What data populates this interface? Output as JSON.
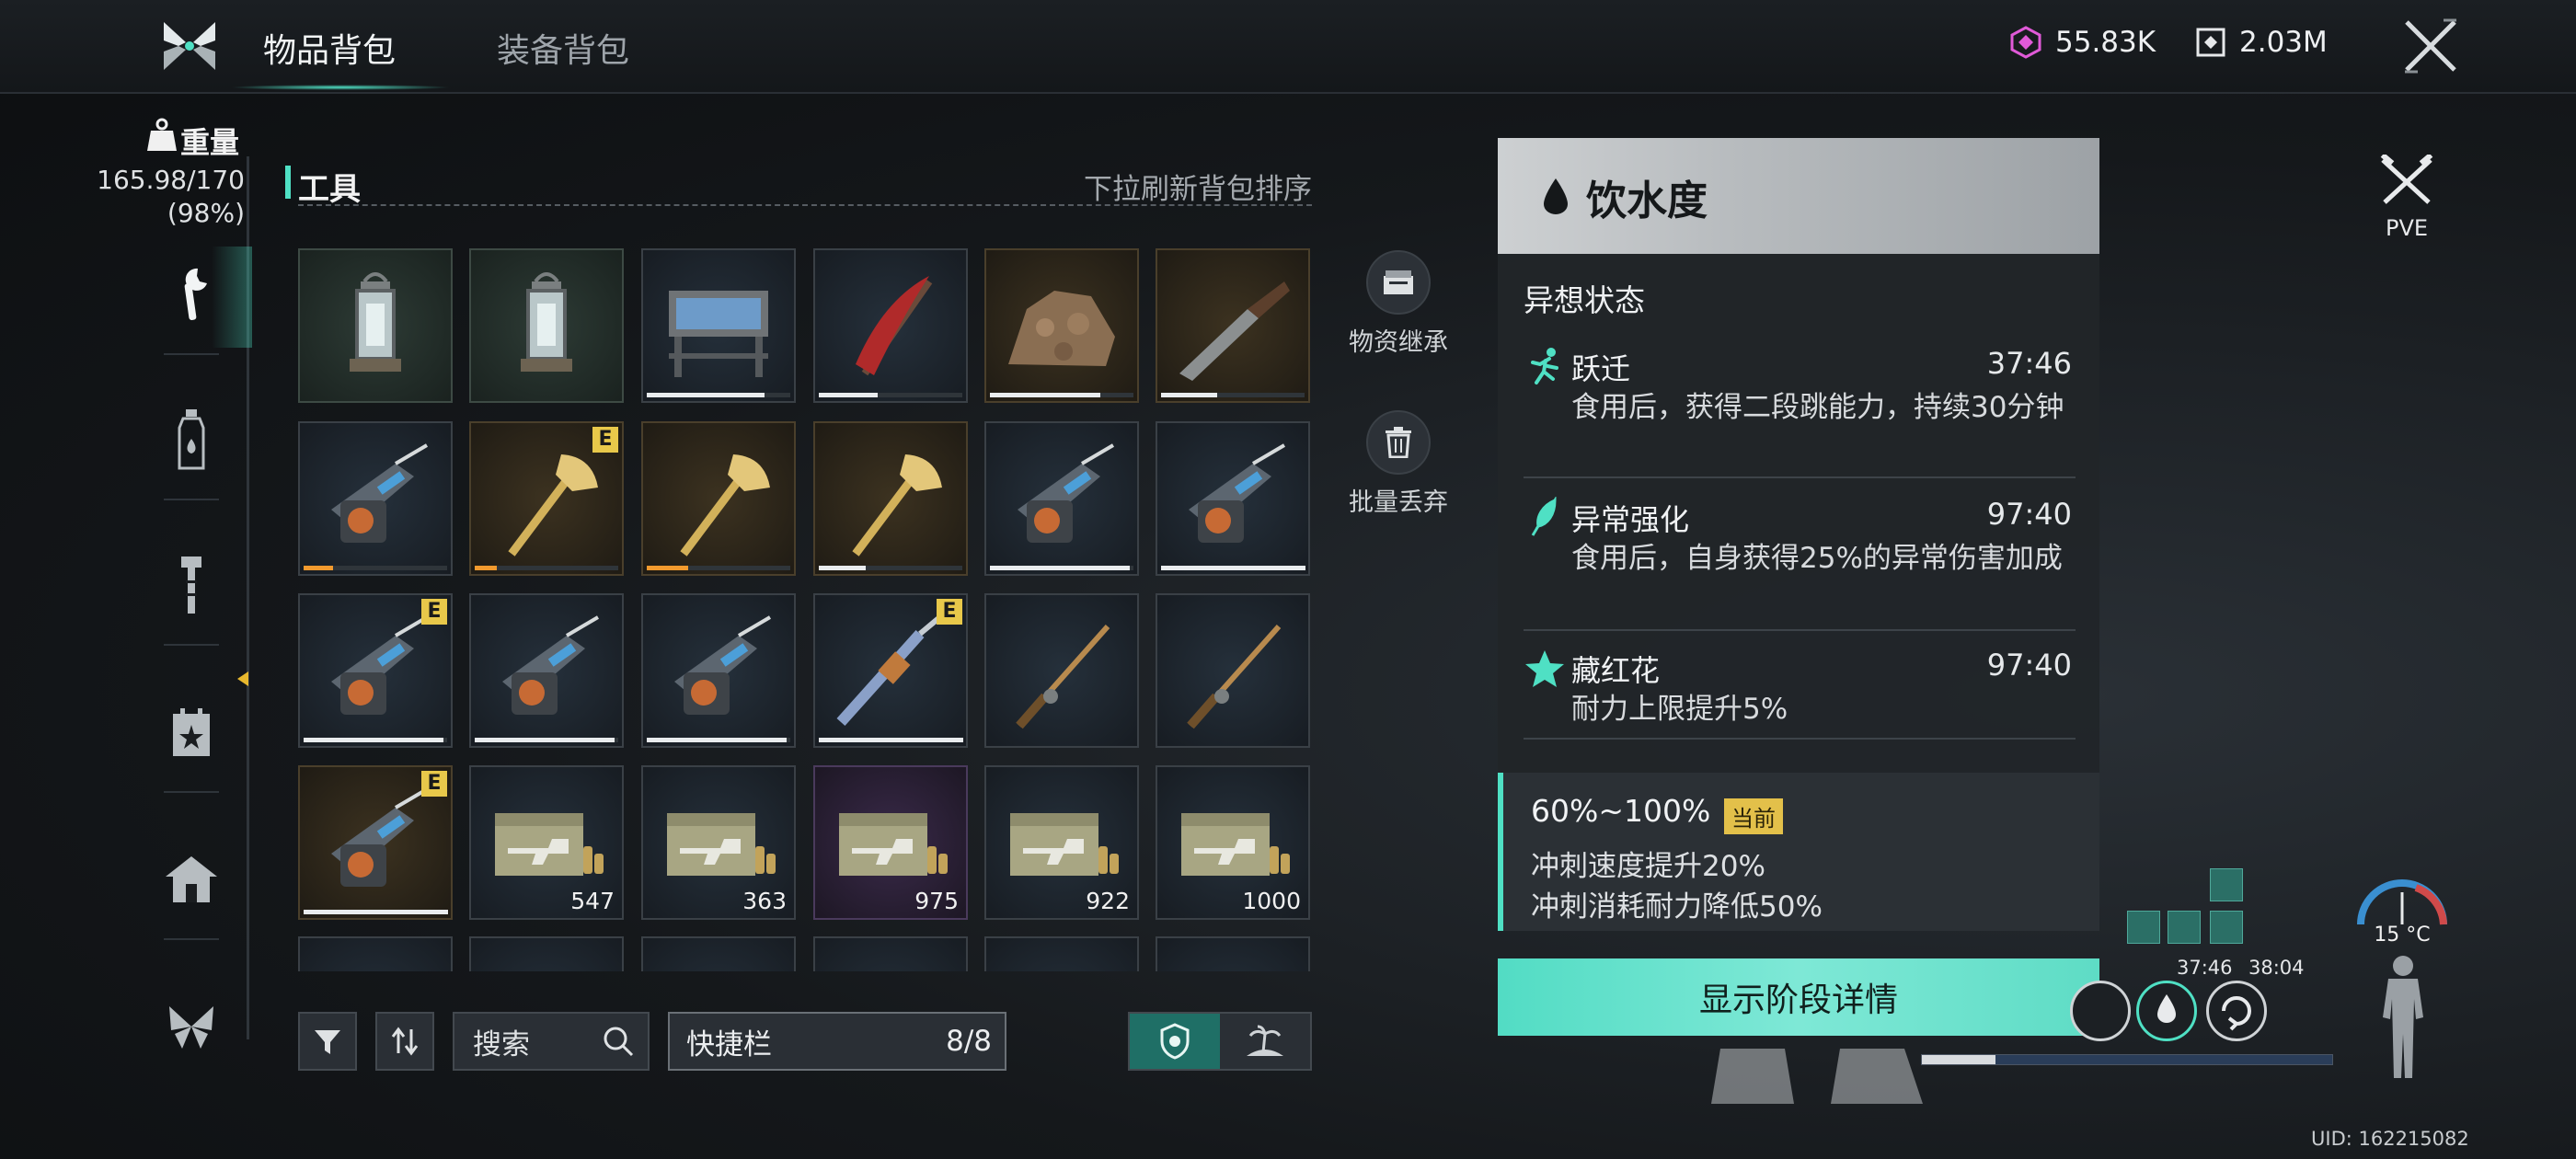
{
  "tabs": [
    {
      "label": "物品背包",
      "active": true
    },
    {
      "label": "装备背包",
      "active": false
    }
  ],
  "currencies": [
    {
      "icon": "crystal-icon",
      "value": "55.83K",
      "color": "#e05ad8"
    },
    {
      "icon": "token-icon",
      "value": "2.03M",
      "color": "#e6e8ea"
    }
  ],
  "weight": {
    "label": "重量",
    "value": "165.98/170",
    "percent": "(98%)"
  },
  "categories": [
    "tools-icon",
    "bottle-icon",
    "hammer-icon",
    "calendar-star-icon",
    "house-icon",
    "butterfly-icon"
  ],
  "inventory": {
    "title": "工具",
    "hint": "下拉刷新背包排序",
    "items": [
      {
        "icon": "lantern-icon",
        "style": "green",
        "bar": null,
        "qty": "",
        "badge": ""
      },
      {
        "icon": "lantern-icon",
        "style": "green",
        "bar": null,
        "qty": "",
        "badge": ""
      },
      {
        "icon": "workbench-icon",
        "style": "blue",
        "bar": 0.8,
        "bar_color": "white",
        "qty": "",
        "badge": ""
      },
      {
        "icon": "pickaxe-icon",
        "style": "blue",
        "bar": 0.4,
        "bar_color": "white",
        "qty": "",
        "badge": ""
      },
      {
        "icon": "ore-pile-icon",
        "style": "gold",
        "bar": 0.75,
        "bar_color": "white",
        "qty": "",
        "badge": ""
      },
      {
        "icon": "knife-icon",
        "style": "gold",
        "bar": 0.38,
        "bar_color": "white",
        "qty": "",
        "badge": ""
      },
      {
        "icon": "chainsaw-icon",
        "style": "blue",
        "bar": 0.2,
        "bar_color": "orange",
        "qty": "",
        "badge": ""
      },
      {
        "icon": "axe-icon",
        "style": "gold",
        "bar": 0.15,
        "bar_color": "orange",
        "qty": "",
        "badge": "E"
      },
      {
        "icon": "axe-icon",
        "style": "gold",
        "bar": 0.28,
        "bar_color": "orange",
        "qty": "",
        "badge": ""
      },
      {
        "icon": "axe-icon",
        "style": "gold",
        "bar": 0.32,
        "bar_color": "white",
        "qty": "",
        "badge": ""
      },
      {
        "icon": "chainsaw-icon",
        "style": "blue",
        "bar": 0.95,
        "bar_color": "white",
        "qty": "",
        "badge": ""
      },
      {
        "icon": "chainsaw-icon",
        "style": "blue",
        "bar": 0.98,
        "bar_color": "white",
        "qty": "",
        "badge": ""
      },
      {
        "icon": "chainsaw-icon",
        "style": "blue",
        "bar": 0.95,
        "bar_color": "white",
        "qty": "",
        "badge": "E"
      },
      {
        "icon": "chainsaw-icon",
        "style": "blue",
        "bar": 0.95,
        "bar_color": "white",
        "qty": "",
        "badge": ""
      },
      {
        "icon": "chainsaw-icon",
        "style": "blue",
        "bar": 0.95,
        "bar_color": "white",
        "qty": "",
        "badge": ""
      },
      {
        "icon": "drill-icon",
        "style": "blue",
        "bar": 0.98,
        "bar_color": "white",
        "qty": "",
        "badge": "E"
      },
      {
        "icon": "fishing-rod-icon",
        "style": "blue",
        "bar": null,
        "qty": "",
        "badge": ""
      },
      {
        "icon": "fishing-rod-icon",
        "style": "blue",
        "bar": null,
        "qty": "",
        "badge": ""
      },
      {
        "icon": "chainsaw-icon",
        "style": "gold",
        "bar": 0.98,
        "bar_color": "white",
        "qty": "",
        "badge": "E"
      },
      {
        "icon": "ammo-crate-icon",
        "style": "blue",
        "bar": null,
        "qty": "547",
        "badge": ""
      },
      {
        "icon": "ammo-crate-icon",
        "style": "blue",
        "bar": null,
        "qty": "363",
        "badge": ""
      },
      {
        "icon": "ammo-crate-icon",
        "style": "purple",
        "bar": null,
        "qty": "975",
        "badge": ""
      },
      {
        "icon": "ammo-crate-icon",
        "style": "blue",
        "bar": null,
        "qty": "922",
        "badge": ""
      },
      {
        "icon": "ammo-crate-icon",
        "style": "blue",
        "bar": null,
        "qty": "1000",
        "badge": ""
      }
    ]
  },
  "actions": [
    {
      "icon": "box-icon",
      "label": "物资继承"
    },
    {
      "icon": "trash-icon",
      "label": "批量丢弃"
    }
  ],
  "toolbar": {
    "search_label": "搜索",
    "quickbar_label": "快捷栏",
    "quickbar_count": "8/8"
  },
  "status": {
    "title": "饮水度",
    "section": "异想状态",
    "effects": [
      {
        "icon": "running-icon",
        "name": "跃迁",
        "time": "37:46",
        "desc": "食用后，获得二段跳能力，持续30分钟"
      },
      {
        "icon": "feather-icon",
        "name": "异常强化",
        "time": "97:40",
        "desc": "食用后，自身获得25%的异常伤害加成"
      },
      {
        "icon": "star-icon",
        "name": "藏红花",
        "time": "97:40",
        "desc": "耐力上限提升5%"
      }
    ],
    "stage": {
      "range": "60%~100%",
      "badge": "当前",
      "line1": "冲刺速度提升20%",
      "line2": "冲刺消耗耐力降低50%"
    },
    "button": "显示阶段详情"
  },
  "hud": {
    "mode": "PVE",
    "timers": [
      "37:46",
      "38:04"
    ],
    "temperature": "15 °C",
    "health_fraction": 0.18,
    "uid": "UID: 162215082"
  },
  "colors": {
    "accent": "#4fe0c4",
    "badge": "#e8c84a",
    "currency_pink": "#e05ad8"
  }
}
